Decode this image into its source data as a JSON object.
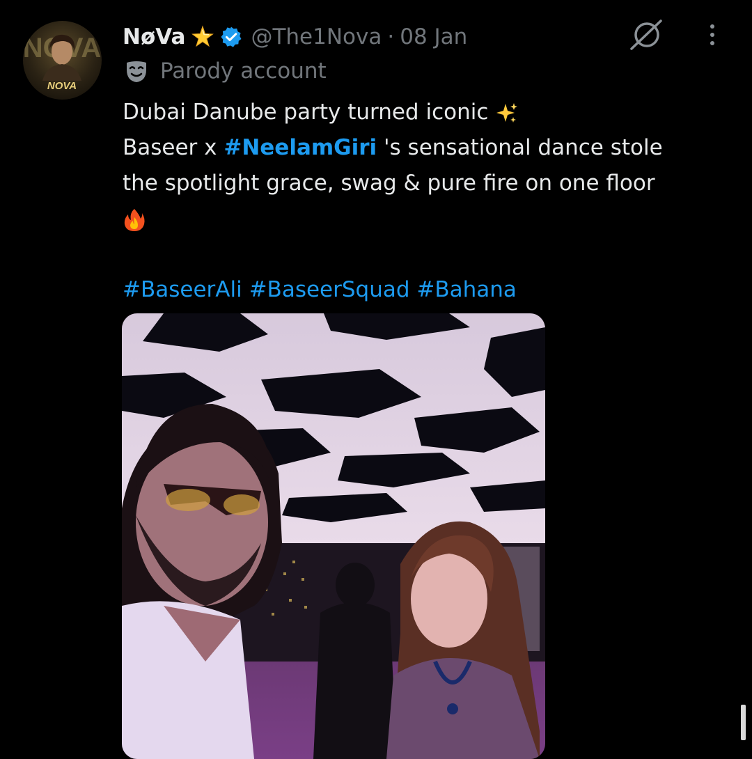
{
  "tweet": {
    "display_name": "NøVa",
    "handle": "@The1Nova",
    "separator": "·",
    "date": "08 Jan",
    "label": "Parody account",
    "avatar_text": "NOVA",
    "text_lines": {
      "line1": "Dubai Danube party turned iconic",
      "line2_prefix": "Baseer x ",
      "line2_hashtag": "#NeelamGiri",
      "line2_suffix": " 's sensational dance stole",
      "line3": "the spotlight  grace, swag & pure fire on one floor"
    },
    "hashtags": [
      "#BaseerAli",
      "#BaseerSquad",
      "#Bahana"
    ],
    "icons": {
      "name_badge": "star-icon",
      "verified": "verified-badge-icon",
      "label": "theater-mask-icon",
      "line1_emoji": "sparkles-icon",
      "line4_emoji": "fire-icon",
      "top_right_1": "grok-icon",
      "top_right_2": "more-vertical-icon"
    },
    "colors": {
      "background": "#000000",
      "primary_text": "#e7e9ea",
      "secondary_text": "#71767b",
      "link": "#1d9bf0"
    }
  }
}
